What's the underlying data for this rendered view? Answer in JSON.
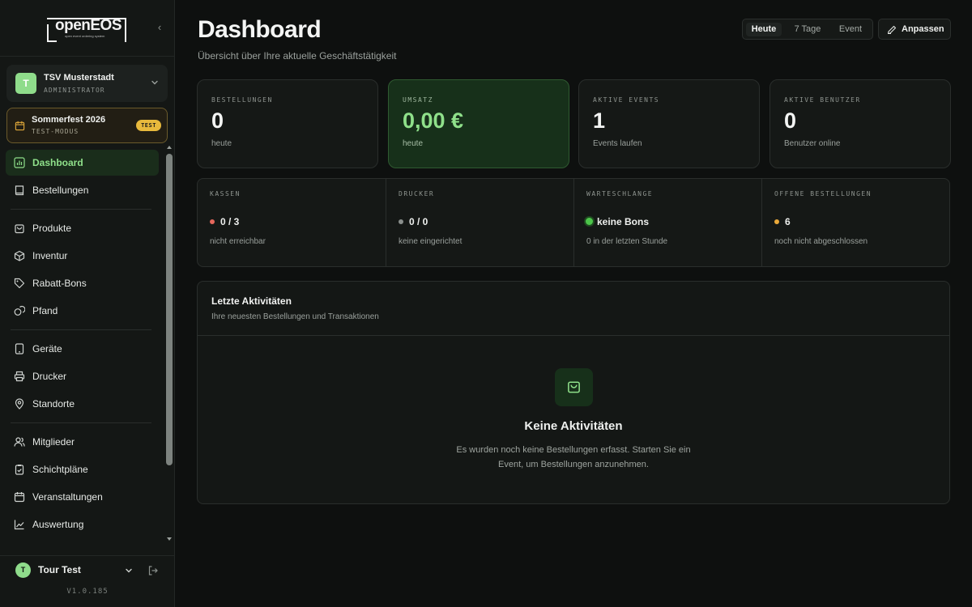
{
  "logo": {
    "text": "openEOS",
    "tagline": "open event ordering system"
  },
  "organization": {
    "initial": "T",
    "name": "TSV Musterstadt",
    "role": "ADMINISTRATOR"
  },
  "event": {
    "name": "Sommerfest 2026",
    "mode": "TEST-MODUS",
    "badge": "TEST"
  },
  "nav": {
    "items": [
      {
        "label": "Dashboard",
        "icon": "bar-chart-icon",
        "active": true
      },
      {
        "label": "Bestellungen",
        "icon": "book-icon"
      },
      {
        "label": "Produkte",
        "icon": "shopping-bag-icon"
      },
      {
        "label": "Inventur",
        "icon": "box-icon"
      },
      {
        "label": "Rabatt-Bons",
        "icon": "tag-icon"
      },
      {
        "label": "Pfand",
        "icon": "coins-icon"
      },
      {
        "label": "Geräte",
        "icon": "tablet-icon"
      },
      {
        "label": "Drucker",
        "icon": "printer-icon"
      },
      {
        "label": "Standorte",
        "icon": "map-pin-icon"
      },
      {
        "label": "Mitglieder",
        "icon": "users-icon"
      },
      {
        "label": "Schichtpläne",
        "icon": "clipboard-check-icon"
      },
      {
        "label": "Veranstaltungen",
        "icon": "calendar-icon"
      },
      {
        "label": "Auswertung",
        "icon": "line-chart-icon"
      }
    ]
  },
  "user": {
    "initial": "T",
    "name": "Tour Test"
  },
  "version": "V1.0.185",
  "header": {
    "title": "Dashboard",
    "subtitle": "Übersicht über Ihre aktuelle Geschäftstätigkeit",
    "ranges": [
      "Heute",
      "7 Tage",
      "Event"
    ],
    "active_range": "Heute",
    "customize_label": "Anpassen"
  },
  "kpis": [
    {
      "label": "BESTELLUNGEN",
      "value": "0",
      "note": "heute"
    },
    {
      "label": "UMSATZ",
      "value": "0,00 €",
      "note": "heute"
    },
    {
      "label": "AKTIVE EVENTS",
      "value": "1",
      "note": "Events laufen"
    },
    {
      "label": "AKTIVE BENUTZER",
      "value": "0",
      "note": "Benutzer online"
    }
  ],
  "status": [
    {
      "label": "KASSEN",
      "value": "0 / 3",
      "note": "nicht erreichbar",
      "dot_color": "#e5675c"
    },
    {
      "label": "DRUCKER",
      "value": "0 / 0",
      "note": "keine eingerichtet",
      "dot_color": "#8a8f8c"
    },
    {
      "label": "WARTESCHLANGE",
      "value": "keine Bons",
      "note": "0 in der letzten Stunde",
      "dot_color": "#4cc54a"
    },
    {
      "label": "OFFENE BESTELLUNGEN",
      "value": "6",
      "note": "noch nicht abgeschlossen",
      "dot_color": "#eaa93a"
    }
  ],
  "activity": {
    "title": "Letzte Aktivitäten",
    "subtitle": "Ihre neuesten Bestellungen und Transaktionen",
    "empty_title": "Keine Aktivitäten",
    "empty_text": "Es wurden noch keine Bestellungen erfasst. Starten Sie ein Event, um Bestellungen anzunehmen."
  },
  "colors": {
    "accent": "#8fe08a",
    "background": "#0e100f",
    "warning_badge": "#e8b93c"
  }
}
